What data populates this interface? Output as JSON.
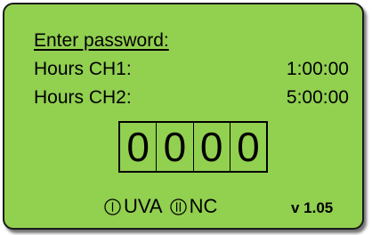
{
  "screen": {
    "title": "Enter password:",
    "rows": [
      {
        "label": "Hours CH1:",
        "value": "1:00:00"
      },
      {
        "label": "Hours CH2:",
        "value": "5:00:00"
      }
    ],
    "password_digits": [
      "0",
      "0",
      "0",
      "0"
    ],
    "channels": [
      {
        "icon": "roman-one-circle-icon",
        "label": "UVA"
      },
      {
        "icon": "roman-two-circle-icon",
        "label": "NC"
      }
    ],
    "version": "v 1.05"
  },
  "colors": {
    "lcd_background": "#92d050",
    "text": "#000000"
  }
}
